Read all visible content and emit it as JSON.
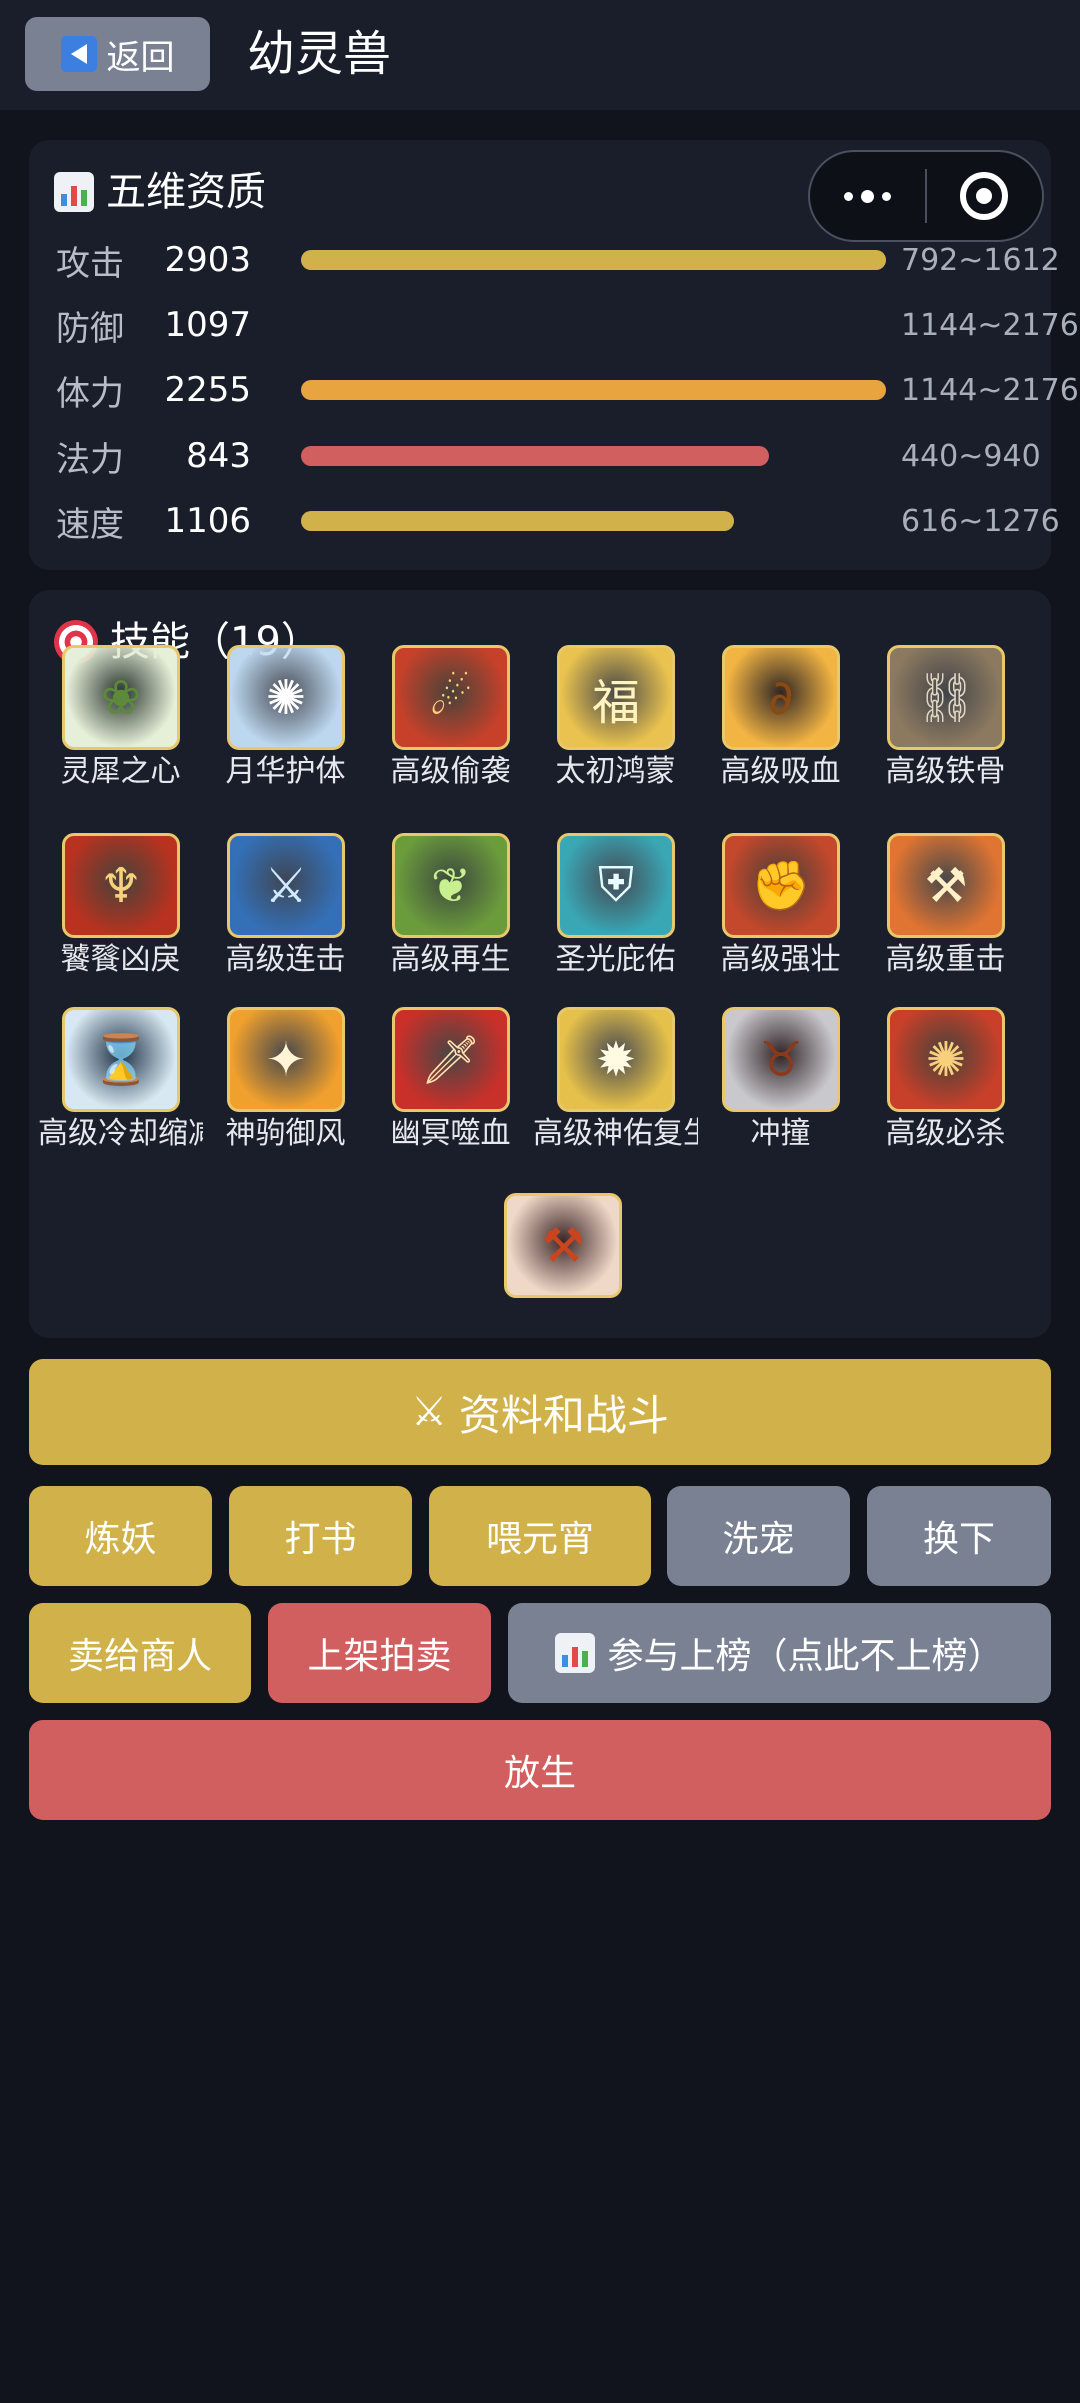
{
  "header": {
    "back_label": "返回",
    "title": "幼灵兽"
  },
  "capsule": {
    "more_icon": "more-dots-icon",
    "close_icon": "target-icon"
  },
  "stats": {
    "title": "五维资质",
    "rows": [
      {
        "label": "攻击",
        "value": "2903",
        "range": "792~1612",
        "fill": 1.0,
        "color": "#d1b24a"
      },
      {
        "label": "防御",
        "value": "1097",
        "range": "1144~2176",
        "fill": 0,
        "color": "#d1b24a"
      },
      {
        "label": "体力",
        "value": "2255",
        "range": "1144~2176",
        "fill": 1.0,
        "color": "#e8a43e"
      },
      {
        "label": "法力",
        "value": "843",
        "range": "440~940",
        "fill": 0.8,
        "color": "#d25f5f"
      },
      {
        "label": "速度",
        "value": "1106",
        "range": "616~1276",
        "fill": 0.74,
        "color": "#d1b24a"
      }
    ]
  },
  "skills": {
    "title": "技能（19）",
    "items": [
      {
        "label": "灵犀之心",
        "icon": "leaf-wreath-icon",
        "glyph": "❀",
        "bg": "#e6efd8",
        "fg": "#5d8a3a"
      },
      {
        "label": "月华护体",
        "icon": "moon-shield-icon",
        "glyph": "✺",
        "bg": "#bcd7ee",
        "fg": "#ffffff"
      },
      {
        "label": "高级偷袭",
        "icon": "fire-strike-icon",
        "glyph": "☄",
        "bg": "#c7412a",
        "fg": "#ffd27a"
      },
      {
        "label": "太初鸿蒙",
        "icon": "fortune-icon",
        "glyph": "福",
        "bg": "#e9c24f",
        "fg": "#fff4c0"
      },
      {
        "label": "高级吸血",
        "icon": "blood-chain-icon",
        "glyph": "∂",
        "bg": "#f2b443",
        "fg": "#8a4a12"
      },
      {
        "label": "高级铁骨",
        "icon": "iron-chain-icon",
        "glyph": "⛓",
        "bg": "#8c7a60",
        "fg": "#e0d6c4"
      },
      {
        "label": "饕餮凶戾",
        "icon": "trident-icon",
        "glyph": "♆",
        "bg": "#b8321f",
        "fg": "#f6d27e"
      },
      {
        "label": "高级连击",
        "icon": "crossed-swords-icon",
        "glyph": "⚔",
        "bg": "#3470b8",
        "fg": "#cfe9ff"
      },
      {
        "label": "高级再生",
        "icon": "leaf-icon",
        "glyph": "❦",
        "bg": "#6b9c3c",
        "fg": "#c9f08e"
      },
      {
        "label": "圣光庇佑",
        "icon": "holy-shield-icon",
        "glyph": "⛨",
        "bg": "#3aa7b5",
        "fg": "#e6fbff"
      },
      {
        "label": "高级强壮",
        "icon": "power-arm-icon",
        "glyph": "✊",
        "bg": "#c4482c",
        "fg": "#f5c46a"
      },
      {
        "label": "高级重击",
        "icon": "hammer-icon",
        "glyph": "⚒",
        "bg": "#e07432",
        "fg": "#fff0c8"
      },
      {
        "label": "高级冷却缩减",
        "icon": "hourglass-icon",
        "glyph": "⌛",
        "bg": "#d7e8f2",
        "fg": "#2f7bb3"
      },
      {
        "label": "神驹御风",
        "icon": "wind-feather-icon",
        "glyph": "✦",
        "bg": "#f0a02d",
        "fg": "#fff4d6"
      },
      {
        "label": "幽冥噬血",
        "icon": "blood-sword-icon",
        "glyph": "🗡",
        "bg": "#c9302a",
        "fg": "#ffe3b0"
      },
      {
        "label": "高级神佑复生",
        "icon": "divine-light-icon",
        "glyph": "✹",
        "bg": "#e5c04a",
        "fg": "#fffbe2"
      },
      {
        "label": "冲撞",
        "icon": "horned-helmet-icon",
        "glyph": "♉",
        "bg": "#c9c9cd",
        "fg": "#8a3a1a"
      },
      {
        "label": "高级必杀",
        "icon": "burst-icon",
        "glyph": "✺",
        "bg": "#c8402a",
        "fg": "#f8cf7a"
      },
      {
        "label": "",
        "icon": "battle-axe-icon",
        "glyph": "⚒",
        "bg": "#f0d8c8",
        "fg": "#c9451e"
      }
    ]
  },
  "actions": {
    "main": "资料和战斗",
    "refine": "炼妖",
    "study": "打书",
    "feed": "喂元宵",
    "wash": "洗宠",
    "swap": "换下",
    "sell": "卖给商人",
    "auction": "上架拍卖",
    "rank": "参与上榜（点此不上榜）",
    "release": "放生"
  }
}
